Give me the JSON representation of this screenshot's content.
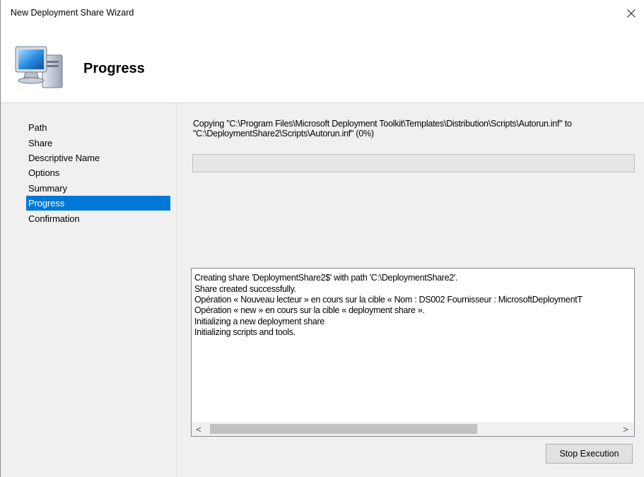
{
  "window": {
    "title": "New Deployment Share Wizard",
    "close_glyph": "✕"
  },
  "header": {
    "title": "Progress",
    "icon": "computer-icon"
  },
  "nav": {
    "items": [
      {
        "label": "Path",
        "selected": false
      },
      {
        "label": "Share",
        "selected": false
      },
      {
        "label": "Descriptive Name",
        "selected": false
      },
      {
        "label": "Options",
        "selected": false
      },
      {
        "label": "Summary",
        "selected": false
      },
      {
        "label": "Progress",
        "selected": true
      },
      {
        "label": "Confirmation",
        "selected": false
      }
    ],
    "selected_color": "#0078d7"
  },
  "progress": {
    "status_line1": "Copying \"C:\\Program Files\\Microsoft Deployment Toolkit\\Templates\\Distribution\\Scripts\\Autorun.inf\" to",
    "status_line2": "\"C:\\DeploymentShare2\\Scripts\\Autorun.inf\" (0%)",
    "percent": 0
  },
  "log": {
    "lines": [
      "Creating share 'DeploymentShare2$' with path 'C:\\DeploymentShare2'.",
      "Share created successfully.",
      "Opération « Nouveau lecteur » en cours sur la cible « Nom : DS002 Fournisseur : MicrosoftDeploymentT",
      "Opération « new » en cours sur la cible « deployment share ».",
      "Initializing a new deployment share",
      "Initializing scripts and tools."
    ],
    "scroll_left_glyph": "<",
    "scroll_right_glyph": ">"
  },
  "buttons": {
    "stop_label": "Stop Execution"
  }
}
